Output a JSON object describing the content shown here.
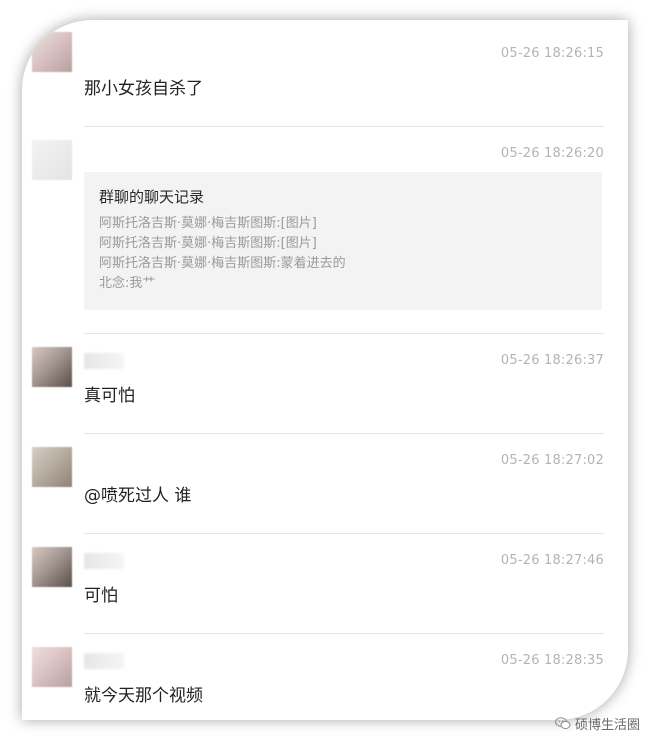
{
  "messages": [
    {
      "type": "text",
      "time": "05-26 18:26:15",
      "text": "那小女孩自杀了"
    },
    {
      "type": "record",
      "time": "05-26 18:26:20",
      "record_title": "群聊的聊天记录",
      "record_lines": [
        "阿斯托洛吉斯·莫娜·梅吉斯图斯:[图片]",
        "阿斯托洛吉斯·莫娜·梅吉斯图斯:[图片]",
        "阿斯托洛吉斯·莫娜·梅吉斯图斯:蒙着进去的",
        "北念:我艹"
      ]
    },
    {
      "type": "text",
      "time": "05-26 18:26:37",
      "text": "真可怕"
    },
    {
      "type": "text",
      "time": "05-26 18:27:02",
      "text": "@喷死过人 谁"
    },
    {
      "type": "text",
      "time": "05-26 18:27:46",
      "text": "可怕"
    },
    {
      "type": "text",
      "time": "05-26 18:28:35",
      "text": "就今天那个视频"
    }
  ],
  "watermark": {
    "text": "硕博生活圈",
    "icon": "wechat-icon"
  }
}
